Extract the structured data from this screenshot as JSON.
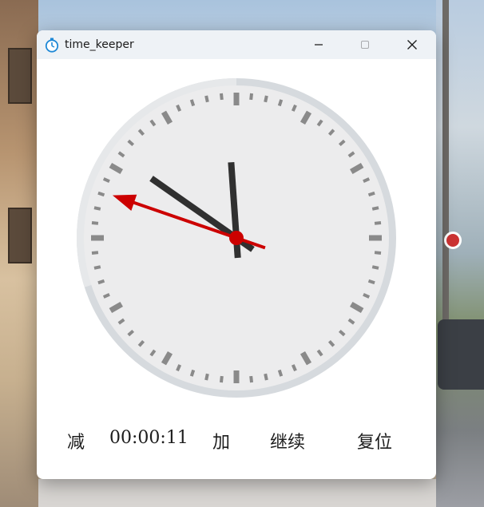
{
  "window": {
    "title": "time_keeper",
    "icon": "stopwatch-icon"
  },
  "title_controls": {
    "minimize_icon": "minimize-icon",
    "maximize_icon": "maximize-icon",
    "close_icon": "close-icon"
  },
  "clock": {
    "hour_hand_angle_deg": 356,
    "minute_hand_angle_deg": 305,
    "second_hand_angle_deg": 289,
    "progress_fraction": 0.7,
    "colors": {
      "face": "#ececed",
      "rim": "#d6dade",
      "rim_progress": "#e6e8ea",
      "hands": "#303030",
      "second_hand": "#cc0000",
      "ticks": "#8a8a8a"
    }
  },
  "controls": {
    "minus_label": "减",
    "timer_value": "00:00:11",
    "plus_label": "加",
    "continue_label": "继续",
    "reset_label": "复位"
  }
}
